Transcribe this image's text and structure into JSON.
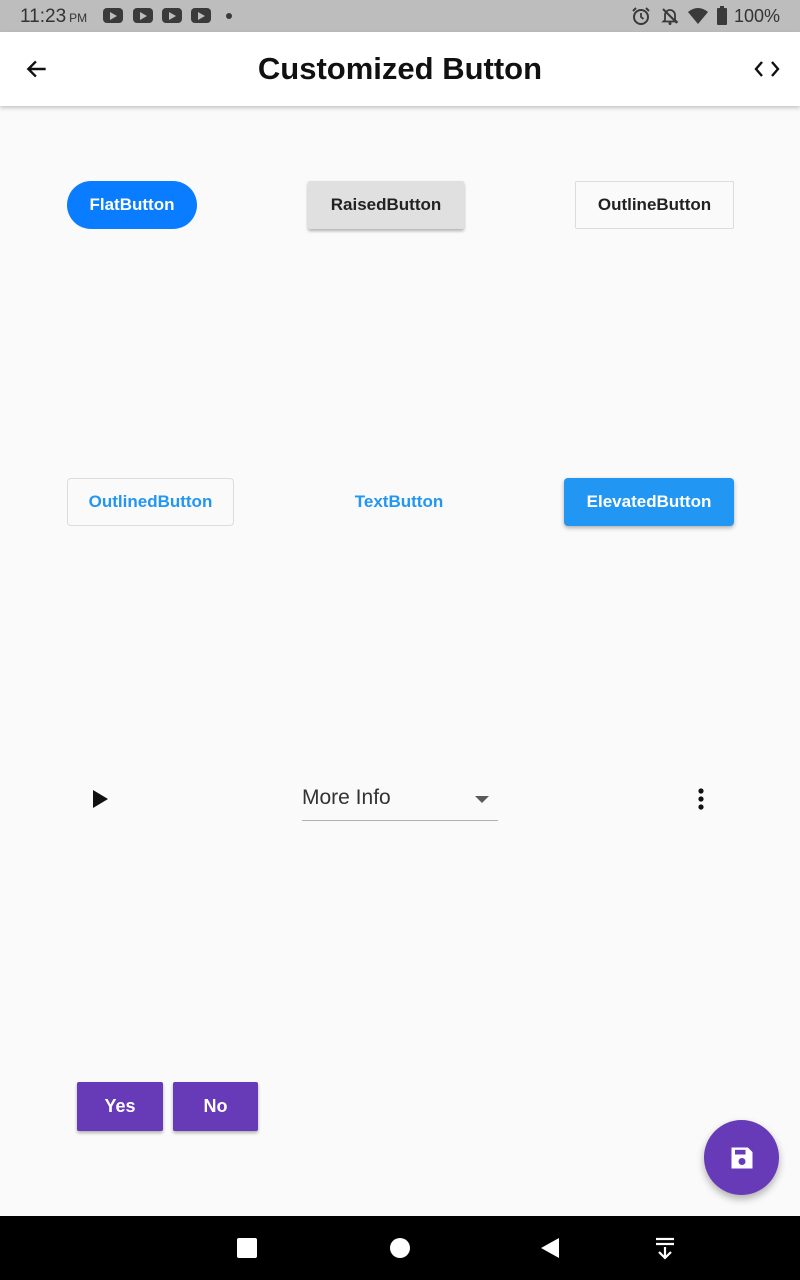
{
  "status_bar": {
    "time": "11:23",
    "ampm": "PM",
    "battery": "100%",
    "icons": [
      "youtube-icon",
      "youtube-icon",
      "youtube-icon",
      "youtube-icon",
      "dot-icon",
      "alarm-icon",
      "notifications-off-icon",
      "wifi-icon",
      "battery-icon"
    ]
  },
  "app_bar": {
    "title": "Customized Button",
    "back_icon": "arrow-back-icon",
    "code_icon": "code-icon"
  },
  "buttons": {
    "flat": "FlatButton",
    "raised": "RaisedButton",
    "outline": "OutlineButton",
    "outlined": "OutlinedButton",
    "text": "TextButton",
    "elevated": "ElevatedButton",
    "yes": "Yes",
    "no": "No"
  },
  "dropdown": {
    "selected": "More Info"
  },
  "icons": {
    "play": "play-arrow-icon",
    "more": "more-vert-icon",
    "fab": "save-icon"
  },
  "nav_bar": {
    "icons": [
      "square-recent-icon",
      "circle-home-icon",
      "triangle-back-icon",
      "collapse-down-icon"
    ]
  },
  "colors": {
    "flat": "#0a7cff",
    "blue": "#2196f3",
    "purple": "#673ab7",
    "raised": "#e0e0e0",
    "background": "#fafafa"
  }
}
